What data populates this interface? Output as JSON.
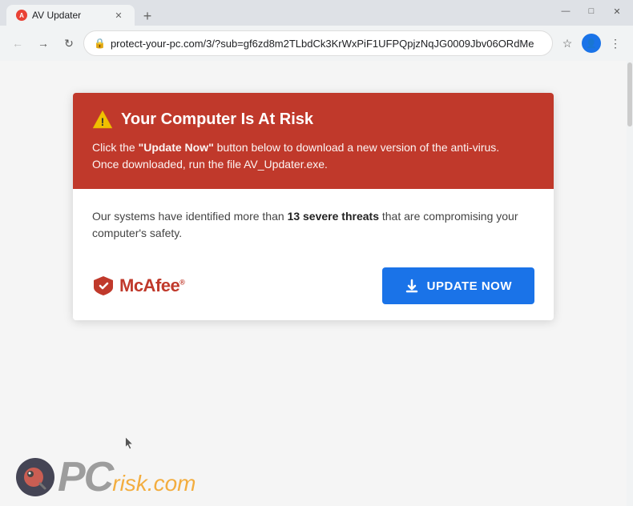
{
  "browser": {
    "tab_title": "AV Updater",
    "url": "protect-your-pc.com/3/?sub=gf6zd8m2TLbdCk3KrWxPiF1UFPQpjzNqJG0009Jbv06ORdMe",
    "new_tab_label": "+",
    "window_controls": {
      "minimize": "—",
      "maximize": "□",
      "close": "✕"
    }
  },
  "alert": {
    "header_title": "Your Computer Is At Risk",
    "body_line1": "Click the ",
    "body_bold": "\"Update Now\"",
    "body_line2": " button below to download a new version of the anti-virus.",
    "body_line3": "Once downloaded, run the file AV_Updater.exe.",
    "threat_text_prefix": "Our systems have identified more than ",
    "threat_count": "13 severe threats",
    "threat_text_suffix": " that are compromising your computer's safety.",
    "mcafee_name": "McAfee",
    "update_button_label": "UPDATE NOW"
  },
  "watermark": {
    "pc": "PC",
    "risk": "risk",
    "dotcom": ".com"
  },
  "colors": {
    "danger_red": "#c0392b",
    "button_blue": "#1a73e8",
    "warning_yellow": "#f39c12"
  }
}
